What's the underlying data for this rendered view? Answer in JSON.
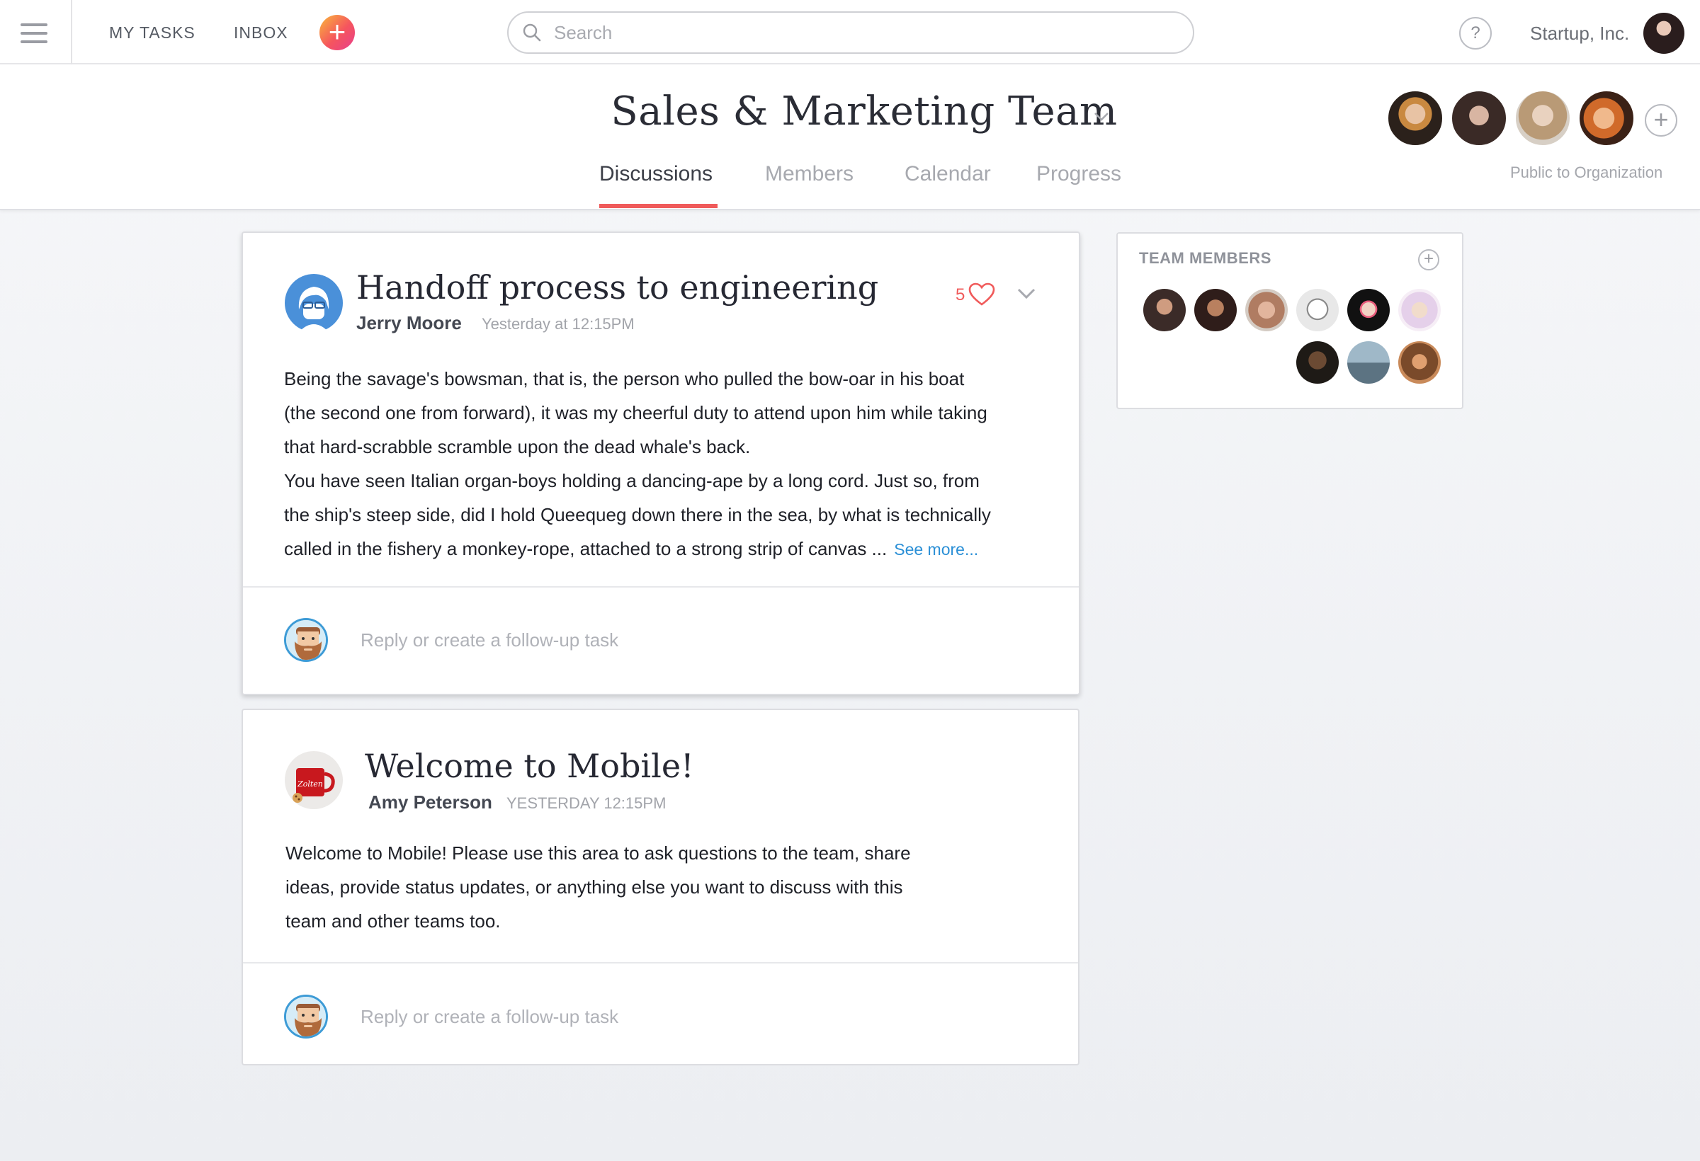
{
  "topbar": {
    "nav": [
      "MY TASKS",
      "INBOX"
    ],
    "add_label": "+",
    "search_placeholder": "Search",
    "help_label": "?",
    "org_name": "Startup, Inc."
  },
  "header": {
    "team_name": "Sales & Marketing Team",
    "tabs": [
      "Discussions",
      "Members",
      "Calendar",
      "Progress"
    ],
    "active_tab": "Discussions",
    "member_add_label": "+",
    "privacy": "Public to Organization"
  },
  "posts": [
    {
      "title": "Handoff process to engineering",
      "author": "Jerry Moore",
      "timestamp": "Yesterday at 12:15PM",
      "likes": "5",
      "body": [
        "Being the savage's bowsman, that is, the person who pulled the bow-oar in his boat",
        "(the second one from forward), it was my cheerful duty to attend upon him while taking",
        "that hard-scrabble scramble upon the dead whale's back.",
        "You have seen Italian organ-boys holding a dancing-ape by a long cord. Just so, from",
        "the ship's steep side, did I hold Queequeg down there in the sea, by what is technically",
        "called in the fishery a monkey-rope, attached to a strong strip of canvas ..."
      ],
      "see_more": "See more...",
      "reply_placeholder": "Reply or create a follow-up task"
    },
    {
      "title": "Welcome to Mobile!",
      "author": "Amy Peterson",
      "timestamp": "YESTERDAY 12:15PM",
      "mug_text": "Zolten",
      "body": [
        "Welcome to Mobile!  Please use this area to ask questions to the team, share",
        "ideas, provide status updates, or anything else you want to discuss with this",
        "team and other teams too."
      ],
      "reply_placeholder": "Reply or create a follow-up task"
    }
  ],
  "team_members_panel": {
    "title": "TEAM MEMBERS",
    "add_label": "+"
  },
  "colors": {
    "accent": "#f05b5b",
    "link": "#2a8fd6"
  }
}
